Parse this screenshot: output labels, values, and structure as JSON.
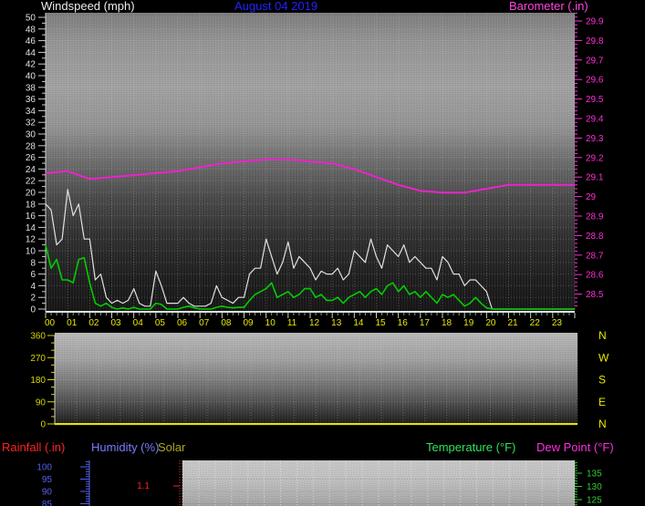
{
  "header": {
    "left_title": "Windspeed (mph)",
    "center_title": "August 04 2019",
    "right_title": "Barometer (.in)"
  },
  "section_labels": {
    "rainfall": "Rainfall (.in)",
    "humidity": "Humidity (%)",
    "solar": "Solar",
    "temperature": "Temperature (°F)",
    "dew_point": "Dew Point (°F)"
  },
  "colors": {
    "background": "#000000",
    "windspeed_title": "#ededed",
    "date_title": "#2222ff",
    "barometer_title": "#ff45e0",
    "barometer_axis": "#ff2fd4",
    "barometer_line": "#ee22cc",
    "windspeed_axis": "#e0e0e0",
    "gust_line": "#e0e0e0",
    "avg_line": "#00cc00",
    "hour_labels": "#e8e800",
    "direction_axis": "#d6d600",
    "direction_line": "#e8e800",
    "rainfall_label": "#ff2222",
    "humidity_label": "#7b7bff",
    "humidity_axis": "#5560f0",
    "solar_label": "#a8a81c",
    "temperature_label": "#2ee25e",
    "temperature_axis": "#33cc33",
    "dew_point_label": "#ff2ee2"
  },
  "chart_data": [
    {
      "type": "line",
      "title": "Windspeed (mph) and Barometer (.in) vs hour of day",
      "x_tick_labels": [
        "00",
        "01",
        "02",
        "03",
        "04",
        "05",
        "06",
        "07",
        "08",
        "09",
        "10",
        "11",
        "12",
        "13",
        "14",
        "15",
        "16",
        "17",
        "18",
        "19",
        "20",
        "21",
        "22",
        "23"
      ],
      "left_axis": {
        "title": "Windspeed (mph)",
        "min": 0,
        "max": 50,
        "step": 2,
        "tick_labels": [
          "50",
          "48",
          "46",
          "44",
          "42",
          "40",
          "38",
          "36",
          "34",
          "32",
          "30",
          "28",
          "26",
          "24",
          "22",
          "20",
          "18",
          "16",
          "14",
          "12",
          "10",
          "8",
          "6",
          "4",
          "2",
          "0"
        ]
      },
      "right_axis": {
        "title": "Barometer (.in)",
        "min": 28.44,
        "max": 29.94,
        "step": 0.1,
        "tick_labels": [
          "29.9",
          "29.8",
          "29.7",
          "29.6",
          "29.5",
          "29.4",
          "29.3",
          "29.2",
          "29.1",
          "29",
          "28.9",
          "28.8",
          "28.7",
          "28.6",
          "28.5"
        ]
      },
      "series": [
        {
          "name": "wind_gust",
          "axis": "left",
          "step_hours": 0.25,
          "values": [
            18,
            17,
            11,
            12,
            20.5,
            16,
            18,
            12,
            12,
            5,
            6,
            2,
            1,
            1.5,
            1,
            1.5,
            3.5,
            1,
            0.5,
            0.5,
            6.5,
            4,
            1,
            1,
            1,
            2,
            1,
            0.5,
            0.5,
            0.5,
            1,
            4,
            2,
            1.5,
            1,
            2,
            2,
            6,
            7,
            7,
            12,
            9,
            6,
            8,
            11.5,
            7,
            9,
            8,
            7,
            5,
            6.5,
            6,
            6,
            7,
            5,
            6,
            10,
            9,
            8,
            12,
            9,
            7,
            11,
            10,
            9,
            11,
            8,
            9,
            8,
            7,
            7,
            5,
            9,
            8,
            6,
            6,
            4,
            5,
            5,
            4,
            3,
            0,
            0,
            0,
            0,
            0,
            0,
            0,
            0,
            0,
            0,
            0,
            0,
            0,
            0,
            0
          ]
        },
        {
          "name": "wind_average",
          "axis": "left",
          "step_hours": 0.25,
          "values": [
            11,
            7,
            8.5,
            5,
            5,
            4.5,
            8.5,
            8.8,
            4.5,
            1,
            0.5,
            1,
            0.3,
            0,
            0.2,
            0,
            0.3,
            0,
            0,
            0,
            1,
            0.8,
            0,
            0,
            0,
            0.3,
            0.5,
            0.2,
            0,
            0,
            0,
            0.3,
            0.5,
            0.3,
            0.2,
            0.3,
            0.3,
            1.5,
            2.5,
            3,
            3.5,
            4.5,
            2,
            2.5,
            3,
            2,
            2.5,
            3.5,
            3.5,
            2,
            2.5,
            1.5,
            1.5,
            2,
            1,
            2,
            2.5,
            3,
            2,
            3,
            3.5,
            2.5,
            4,
            4.5,
            3,
            4,
            2.5,
            3,
            2,
            3,
            2,
            1,
            2.5,
            2,
            2.5,
            1.5,
            0.5,
            1,
            2,
            1,
            0.2,
            0,
            0,
            0,
            0,
            0,
            0,
            0,
            0,
            0,
            0,
            0,
            0,
            0,
            0,
            0
          ]
        },
        {
          "name": "barometer",
          "axis": "right",
          "step_hours": 1,
          "values": [
            29.12,
            29.13,
            29.09,
            29.1,
            29.11,
            29.12,
            29.13,
            29.15,
            29.17,
            29.18,
            29.19,
            29.19,
            29.18,
            29.17,
            29.14,
            29.1,
            29.06,
            29.03,
            29.02,
            29.02,
            29.04,
            29.06,
            29.06,
            29.06
          ]
        }
      ]
    },
    {
      "type": "line",
      "title": "Wind Direction (degrees) vs hour of day",
      "left_axis": {
        "min": 0,
        "max": 360,
        "tick_labels": [
          "360",
          "270",
          "180",
          "90",
          "0"
        ]
      },
      "right_axis": {
        "tick_labels": [
          "N",
          "W",
          "S",
          "E",
          "N"
        ]
      },
      "series": [
        {
          "name": "wind_direction",
          "step_hours": 1,
          "values": [
            0,
            0,
            0,
            0,
            0,
            0,
            0,
            0,
            0,
            0,
            0,
            0,
            0,
            0,
            0,
            0,
            0,
            0,
            0,
            0,
            0,
            0,
            0,
            0
          ]
        }
      ]
    },
    {
      "type": "line",
      "title": "Rainfall / Humidity / Solar / Temperature / Dew Point (panel cut off at bottom of screen)",
      "humidity_axis": {
        "unit": "%",
        "tick_labels": [
          "100",
          "95",
          "90",
          "85"
        ]
      },
      "rainfall_axis": {
        "unit": ".in",
        "tick_labels": [
          "1.1"
        ]
      },
      "temperature_axis": {
        "unit": "°F",
        "tick_labels": [
          "135",
          "130",
          "125"
        ]
      },
      "series": []
    }
  ]
}
